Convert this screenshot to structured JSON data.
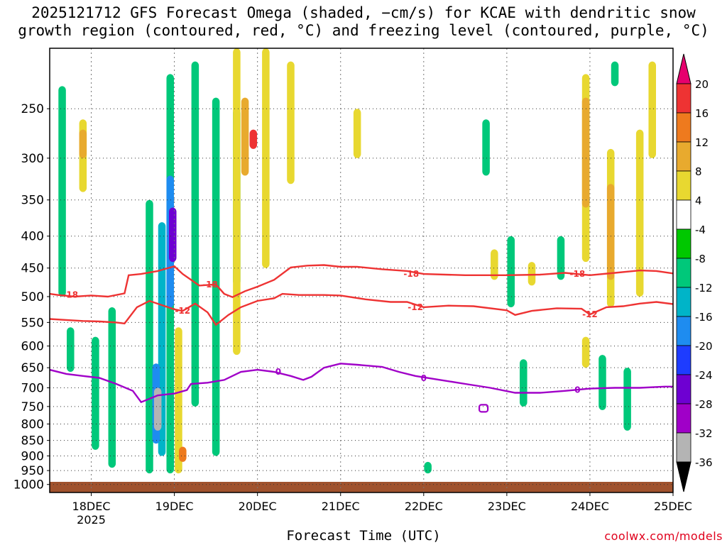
{
  "title": {
    "line1": "2025121712 GFS Forecast Omega (shaded, −cm/s) for KCAE with dendritic snow",
    "line2": "growth region (contoured, red, °C) and freezing level (contoured, purple, °C)"
  },
  "credit": "coolwx.com/models",
  "chart_data": {
    "type": "heatmap",
    "title": "2025121712 GFS Forecast Omega (shaded, −cm/s) for KCAE with dendritic snow growth region (contoured, red, °C) and freezing level (contoured, purple, °C)",
    "xlabel": "Forecast Time (UTC)",
    "ylabel": "",
    "x_ticks": [
      "18DEC",
      "19DEC",
      "20DEC",
      "21DEC",
      "22DEC",
      "23DEC",
      "24DEC",
      "25DEC"
    ],
    "x_tick_sub": {
      "18DEC": "2025"
    },
    "xlim_days": [
      17.5,
      25.0
    ],
    "y_scale": "log (pressure, reversed)",
    "ylim": [
      1030,
      200
    ],
    "y_ticks": [
      250,
      300,
      350,
      400,
      450,
      500,
      550,
      600,
      650,
      700,
      750,
      800,
      850,
      900,
      950,
      1000
    ],
    "grid": true,
    "colorbar": {
      "levels": [
        20,
        16,
        12,
        8,
        4,
        -4,
        -8,
        -12,
        -16,
        -20,
        -24,
        -28,
        -32,
        -36
      ],
      "colors": [
        "#e6006e",
        "#ee3333",
        "#ee7a1e",
        "#e8aa2e",
        "#e8d830",
        "#ffffff",
        "#00c800",
        "#00c87a",
        "#00b4c8",
        "#1e8cf0",
        "#1e3cff",
        "#6e00d2",
        "#a000c8",
        "#b4b4b4",
        "#000000"
      ]
    },
    "contours": [
      {
        "name": "-18",
        "color": "#ee3333",
        "points": [
          [
            17.5,
            495
          ],
          [
            17.6,
            497
          ],
          [
            17.8,
            500
          ],
          [
            18.0,
            498
          ],
          [
            18.2,
            500
          ],
          [
            18.4,
            494
          ],
          [
            18.45,
            462
          ],
          [
            18.6,
            460
          ],
          [
            18.8,
            455
          ],
          [
            19.0,
            447
          ],
          [
            19.1,
            460
          ],
          [
            19.3,
            480
          ],
          [
            19.5,
            478
          ],
          [
            19.6,
            495
          ],
          [
            19.7,
            501
          ],
          [
            19.85,
            490
          ],
          [
            20.0,
            482
          ],
          [
            20.2,
            470
          ],
          [
            20.4,
            449
          ],
          [
            20.6,
            446
          ],
          [
            20.8,
            445
          ],
          [
            21.0,
            448
          ],
          [
            21.2,
            448
          ],
          [
            21.5,
            452
          ],
          [
            21.8,
            455
          ],
          [
            22.0,
            460
          ],
          [
            22.5,
            462
          ],
          [
            23.0,
            462
          ],
          [
            23.4,
            461
          ],
          [
            23.7,
            458
          ],
          [
            24.0,
            462
          ],
          [
            24.3,
            458
          ],
          [
            24.6,
            454
          ],
          [
            24.8,
            455
          ],
          [
            25.0,
            459
          ]
        ]
      },
      {
        "name": "-12",
        "color": "#ee3333",
        "points": [
          [
            17.5,
            543
          ],
          [
            17.7,
            545
          ],
          [
            17.9,
            547
          ],
          [
            18.1,
            548
          ],
          [
            18.3,
            550
          ],
          [
            18.4,
            552
          ],
          [
            18.55,
            520
          ],
          [
            18.7,
            508
          ],
          [
            18.85,
            516
          ],
          [
            19.0,
            524
          ],
          [
            19.1,
            527
          ],
          [
            19.25,
            513
          ],
          [
            19.4,
            530
          ],
          [
            19.5,
            555
          ],
          [
            19.65,
            535
          ],
          [
            19.8,
            520
          ],
          [
            20.0,
            508
          ],
          [
            20.2,
            503
          ],
          [
            20.3,
            495
          ],
          [
            20.5,
            497
          ],
          [
            20.8,
            497
          ],
          [
            21.0,
            498
          ],
          [
            21.3,
            505
          ],
          [
            21.6,
            510
          ],
          [
            21.8,
            510
          ],
          [
            22.0,
            520
          ],
          [
            22.3,
            517
          ],
          [
            22.6,
            518
          ],
          [
            23.0,
            526
          ],
          [
            23.1,
            535
          ],
          [
            23.3,
            527
          ],
          [
            23.6,
            522
          ],
          [
            23.9,
            523
          ],
          [
            24.0,
            534
          ],
          [
            24.2,
            520
          ],
          [
            24.4,
            518
          ],
          [
            24.6,
            513
          ],
          [
            24.8,
            510
          ],
          [
            25.0,
            514
          ]
        ]
      },
      {
        "name": "0",
        "color": "#a000c8",
        "points": [
          [
            17.5,
            655
          ],
          [
            17.7,
            665
          ],
          [
            17.9,
            670
          ],
          [
            18.1,
            675
          ],
          [
            18.3,
            690
          ],
          [
            18.5,
            708
          ],
          [
            18.6,
            738
          ],
          [
            18.8,
            720
          ],
          [
            19.0,
            715
          ],
          [
            19.15,
            706
          ],
          [
            19.2,
            690
          ],
          [
            19.4,
            687
          ],
          [
            19.6,
            680
          ],
          [
            19.8,
            660
          ],
          [
            20.0,
            655
          ],
          [
            20.2,
            660
          ],
          [
            20.4,
            670
          ],
          [
            20.55,
            680
          ],
          [
            20.65,
            672
          ],
          [
            20.8,
            650
          ],
          [
            21.0,
            640
          ],
          [
            21.2,
            643
          ],
          [
            21.5,
            648
          ],
          [
            21.7,
            660
          ],
          [
            21.9,
            670
          ],
          [
            22.2,
            680
          ],
          [
            22.5,
            690
          ],
          [
            22.8,
            700
          ],
          [
            23.1,
            713
          ],
          [
            23.4,
            713
          ],
          [
            23.7,
            708
          ],
          [
            24.0,
            702
          ],
          [
            24.3,
            700
          ],
          [
            24.6,
            700
          ],
          [
            24.9,
            697
          ],
          [
            25.0,
            697
          ]
        ]
      }
    ],
    "contour_labels": [
      {
        "text": "-18",
        "x": 17.75,
        "y": 497,
        "color": "#ee3333"
      },
      {
        "text": "-18",
        "x": 19.43,
        "y": 478,
        "color": "#ee3333"
      },
      {
        "text": "-18",
        "x": 21.85,
        "y": 460,
        "color": "#ee3333"
      },
      {
        "text": "-18",
        "x": 23.85,
        "y": 460,
        "color": "#ee3333"
      },
      {
        "text": "-12",
        "x": 19.1,
        "y": 527,
        "color": "#ee3333"
      },
      {
        "text": "-12",
        "x": 21.9,
        "y": 520,
        "color": "#ee3333"
      },
      {
        "text": "-12",
        "x": 24.0,
        "y": 534,
        "color": "#ee3333"
      },
      {
        "text": "0",
        "x": 20.25,
        "y": 660,
        "color": "#a000c8"
      },
      {
        "text": "0",
        "x": 22.0,
        "y": 676,
        "color": "#a000c8"
      },
      {
        "text": "0",
        "x": 23.85,
        "y": 706,
        "color": "#a000c8"
      }
    ],
    "shaded_features": [
      {
        "kind": "rise",
        "level": -8,
        "x": 17.65,
        "p0": 230,
        "p1": 500
      },
      {
        "kind": "rise",
        "level": -8,
        "x": 17.75,
        "p0": 560,
        "p1": 660
      },
      {
        "kind": "rise",
        "level": -8,
        "x": 18.05,
        "p0": 580,
        "p1": 880
      },
      {
        "kind": "rise",
        "level": -8,
        "x": 18.25,
        "p0": 520,
        "p1": 940
      },
      {
        "kind": "rise",
        "level": -8,
        "x": 18.7,
        "p0": 350,
        "p1": 960
      },
      {
        "kind": "rise",
        "level": -8,
        "x": 18.95,
        "p0": 220,
        "p1": 960
      },
      {
        "kind": "rise",
        "level": -12,
        "x": 18.85,
        "p0": 380,
        "p1": 900
      },
      {
        "kind": "rise",
        "level": -16,
        "x": 18.95,
        "p0": 320,
        "p1": 520
      },
      {
        "kind": "rise",
        "level": -24,
        "x": 18.98,
        "p0": 360,
        "p1": 440
      },
      {
        "kind": "rise",
        "level": -16,
        "x": 18.78,
        "p0": 640,
        "p1": 860
      },
      {
        "kind": "rise",
        "level": -32,
        "x": 18.8,
        "p0": 700,
        "p1": 820
      },
      {
        "kind": "rise",
        "level": -8,
        "x": 19.25,
        "p0": 210,
        "p1": 750
      },
      {
        "kind": "rise",
        "level": -8,
        "x": 19.5,
        "p0": 240,
        "p1": 900
      },
      {
        "kind": "rise",
        "level": -8,
        "x": 19.75,
        "p0": 250,
        "p1": 480
      },
      {
        "kind": "rise",
        "level": -8,
        "x": 22.75,
        "p0": 260,
        "p1": 320
      },
      {
        "kind": "rise",
        "level": -8,
        "x": 23.05,
        "p0": 400,
        "p1": 520
      },
      {
        "kind": "rise",
        "level": -8,
        "x": 23.2,
        "p0": 630,
        "p1": 750
      },
      {
        "kind": "rise",
        "level": -8,
        "x": 23.65,
        "p0": 400,
        "p1": 470
      },
      {
        "kind": "rise",
        "level": -8,
        "x": 24.15,
        "p0": 620,
        "p1": 760
      },
      {
        "kind": "rise",
        "level": -8,
        "x": 24.45,
        "p0": 650,
        "p1": 820
      },
      {
        "kind": "rise",
        "level": -8,
        "x": 24.3,
        "p0": 210,
        "p1": 230
      },
      {
        "kind": "rise",
        "level": -8,
        "x": 22.05,
        "p0": 920,
        "p1": 960
      },
      {
        "kind": "sink",
        "level": 4,
        "x": 17.9,
        "p0": 260,
        "p1": 340
      },
      {
        "kind": "sink",
        "level": 8,
        "x": 17.9,
        "p0": 270,
        "p1": 300
      },
      {
        "kind": "sink",
        "level": 4,
        "x": 19.05,
        "p0": 560,
        "p1": 960
      },
      {
        "kind": "sink",
        "level": 12,
        "x": 19.1,
        "p0": 870,
        "p1": 920
      },
      {
        "kind": "sink",
        "level": 4,
        "x": 19.75,
        "p0": 200,
        "p1": 620
      },
      {
        "kind": "sink",
        "level": 8,
        "x": 19.85,
        "p0": 240,
        "p1": 320
      },
      {
        "kind": "sink",
        "level": 16,
        "x": 19.95,
        "p0": 270,
        "p1": 290
      },
      {
        "kind": "sink",
        "level": 4,
        "x": 20.1,
        "p0": 200,
        "p1": 450
      },
      {
        "kind": "sink",
        "level": 4,
        "x": 20.4,
        "p0": 210,
        "p1": 330
      },
      {
        "kind": "sink",
        "level": 4,
        "x": 21.2,
        "p0": 250,
        "p1": 300
      },
      {
        "kind": "sink",
        "level": 4,
        "x": 22.85,
        "p0": 420,
        "p1": 470
      },
      {
        "kind": "sink",
        "level": 4,
        "x": 23.3,
        "p0": 440,
        "p1": 480
      },
      {
        "kind": "sink",
        "level": 4,
        "x": 23.95,
        "p0": 220,
        "p1": 440
      },
      {
        "kind": "sink",
        "level": 8,
        "x": 23.95,
        "p0": 240,
        "p1": 360
      },
      {
        "kind": "sink",
        "level": 4,
        "x": 24.25,
        "p0": 290,
        "p1": 520
      },
      {
        "kind": "sink",
        "level": 8,
        "x": 24.25,
        "p0": 330,
        "p1": 470
      },
      {
        "kind": "sink",
        "level": 4,
        "x": 24.6,
        "p0": 270,
        "p1": 500
      },
      {
        "kind": "sink",
        "level": 4,
        "x": 24.75,
        "p0": 210,
        "p1": 300
      },
      {
        "kind": "sink",
        "level": 4,
        "x": 23.95,
        "p0": 580,
        "p1": 650
      }
    ]
  }
}
